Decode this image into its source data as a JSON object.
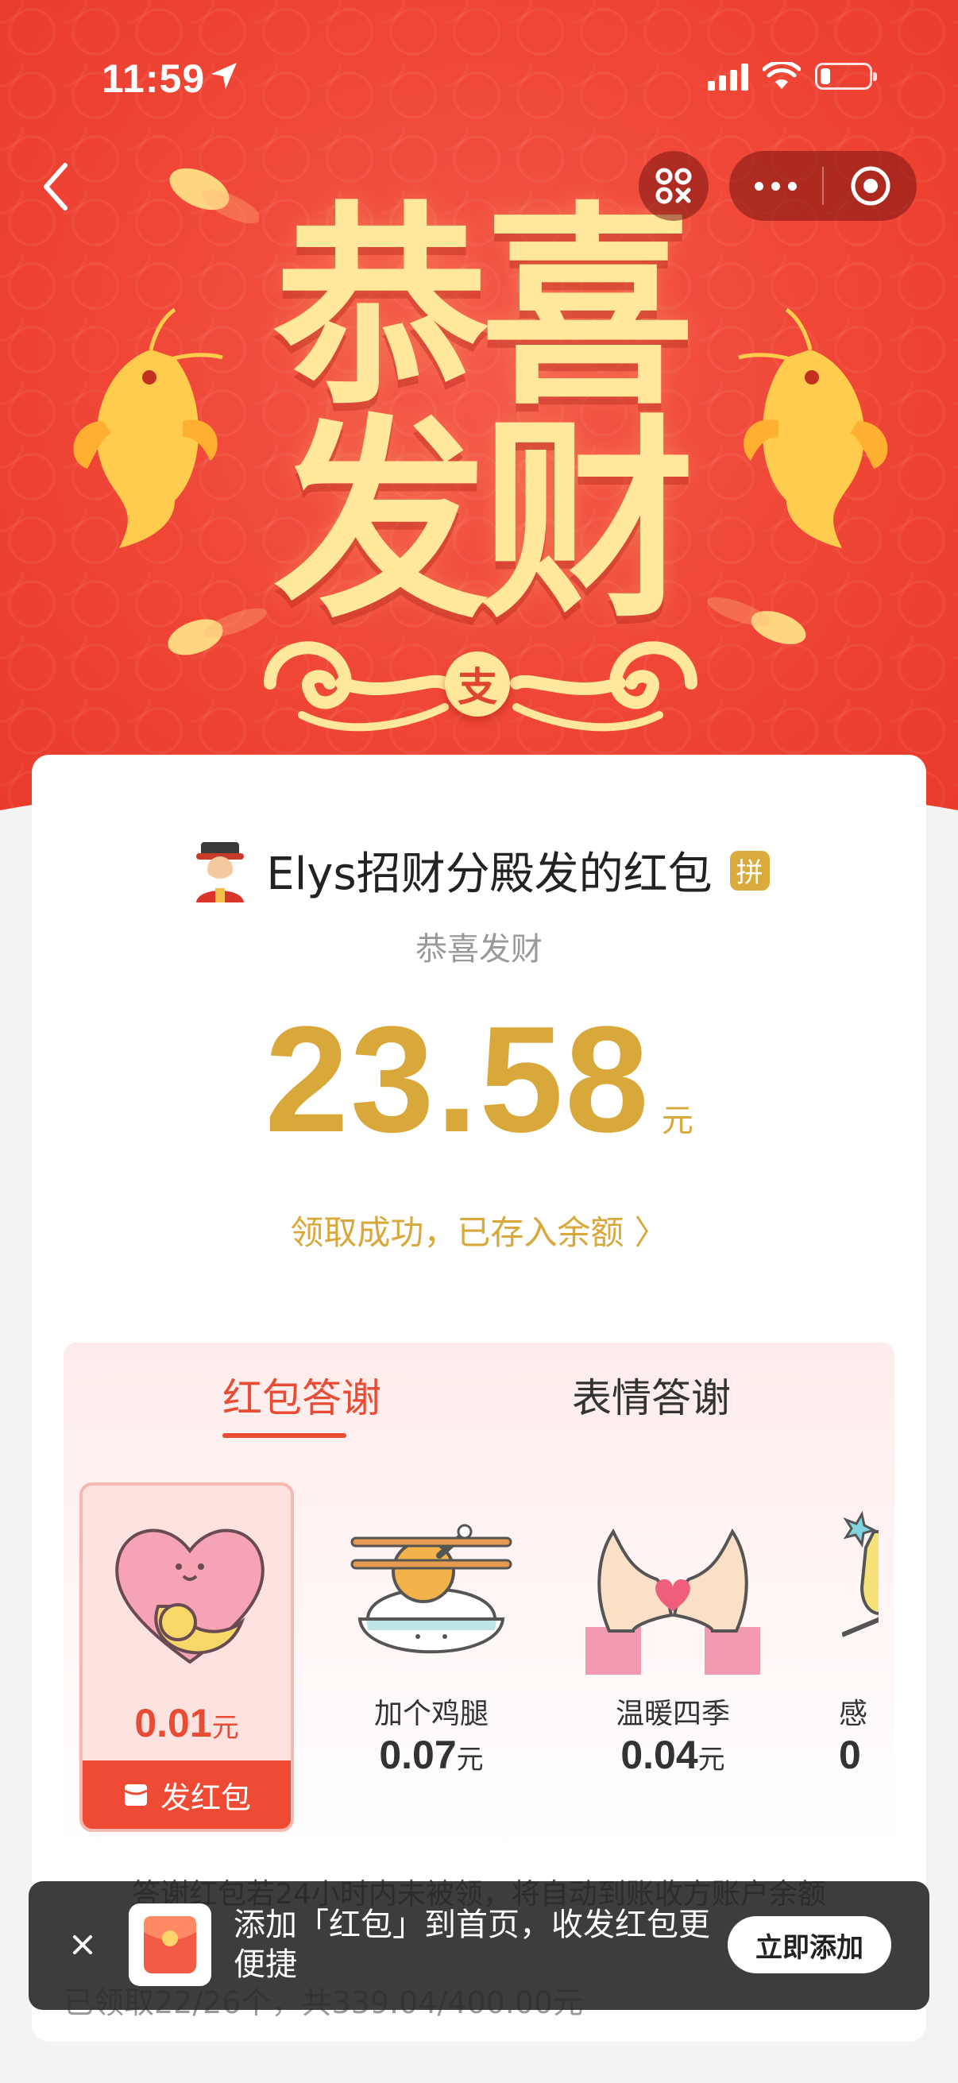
{
  "status_bar": {
    "time": "11:59"
  },
  "banner": {
    "title_line1": "恭喜",
    "title_line2": "发财",
    "badge": "支"
  },
  "envelope": {
    "sender": "Elys招财分殿发的红包",
    "pin_badge": "拼",
    "blessing": "恭喜发财",
    "amount": "23.58",
    "unit": "元",
    "deposit_text": "领取成功，已存入余额 〉"
  },
  "thanks": {
    "tabs": [
      {
        "label": "红包答谢",
        "active": true
      },
      {
        "label": "表情答谢",
        "active": false
      }
    ],
    "gifts": [
      {
        "icon": "heart-hug-icon",
        "name": "",
        "price": "0.01",
        "unit": "元",
        "selected": true
      },
      {
        "icon": "chicken-leg-rice-icon",
        "name": "加个鸡腿",
        "price": "0.07",
        "unit": "元"
      },
      {
        "icon": "heart-hands-icon",
        "name": "温暖四季",
        "price": "0.04",
        "unit": "元"
      },
      {
        "icon": "star-wand-icon",
        "name": "感",
        "price": "0",
        "unit": ""
      }
    ],
    "send_button": "发红包"
  },
  "notice": "答谢红包若24小时内未被领，将自动到账收方账户余额",
  "stats": "已领取22/26个，共339.04/400.00元",
  "toast": {
    "text": "添加「红包」到首页，收发红包更便捷",
    "button": "立即添加"
  },
  "colors": {
    "brand_red": "#ef4636",
    "gold": "#d9a83a",
    "accent_red": "#e94b35"
  }
}
